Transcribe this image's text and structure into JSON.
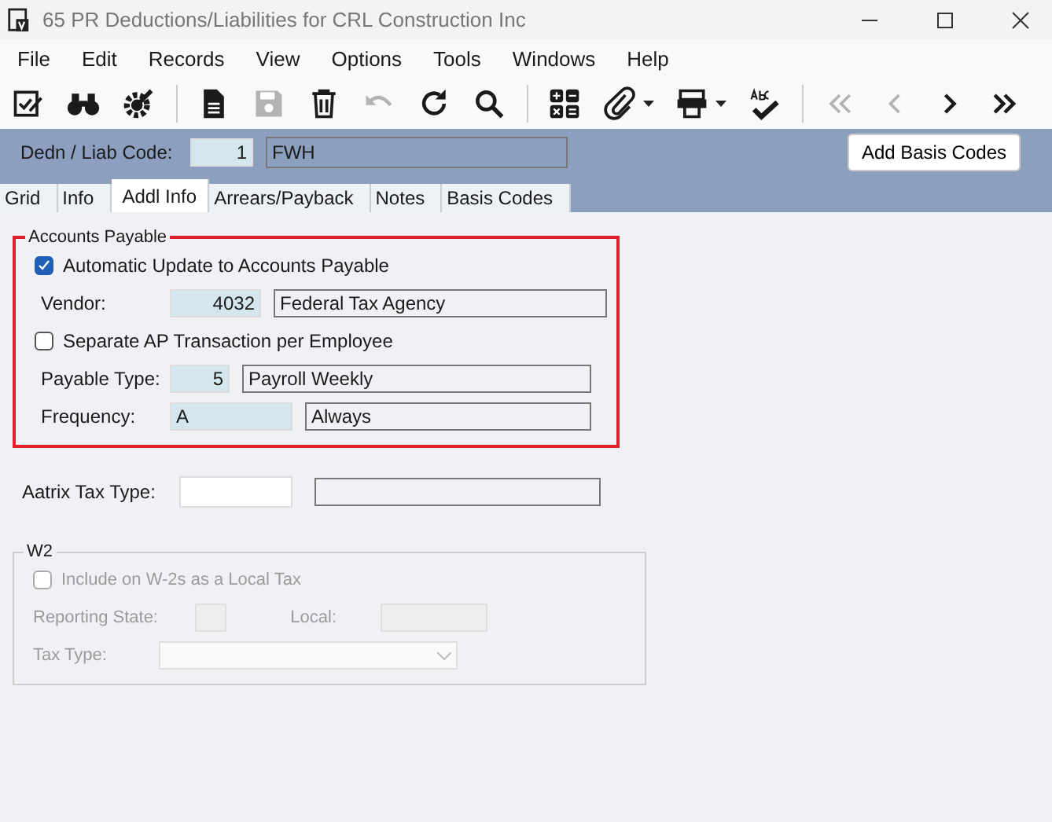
{
  "window": {
    "title": "65 PR Deductions/Liabilities for CRL Construction Inc"
  },
  "menu": [
    "File",
    "Edit",
    "Records",
    "View",
    "Options",
    "Tools",
    "Windows",
    "Help"
  ],
  "toolbar": [
    [
      {
        "kind": "checklist",
        "disabled": false
      },
      {
        "kind": "binoculars",
        "disabled": false
      },
      {
        "kind": "gear",
        "disabled": false
      }
    ],
    [
      {
        "kind": "document",
        "disabled": false
      },
      {
        "kind": "save",
        "disabled": true
      },
      {
        "kind": "trash",
        "disabled": false
      },
      {
        "kind": "undo",
        "disabled": true
      },
      {
        "kind": "refresh",
        "disabled": false
      },
      {
        "kind": "search",
        "disabled": false
      }
    ],
    [
      {
        "kind": "calculator",
        "disabled": false
      },
      {
        "kind": "paperclip",
        "disabled": false,
        "has_menu": true
      },
      {
        "kind": "printer",
        "disabled": false,
        "has_menu": true
      },
      {
        "kind": "spellcheck",
        "disabled": false
      }
    ],
    [
      {
        "kind": "first",
        "disabled": true
      },
      {
        "kind": "prev",
        "disabled": true
      },
      {
        "kind": "next",
        "disabled": false
      },
      {
        "kind": "last",
        "disabled": false
      }
    ]
  ],
  "header": {
    "code_label": "Dedn / Liab Code:",
    "code": "1",
    "description": "FWH",
    "button": "Add Basis Codes"
  },
  "tabs": [
    {
      "label": "Grid",
      "selected": false
    },
    {
      "label": "Info",
      "selected": false
    },
    {
      "label": "Addl Info",
      "selected": true
    },
    {
      "label": "Arrears/Payback",
      "selected": false
    },
    {
      "label": "Notes",
      "selected": false
    },
    {
      "label": "Basis Codes",
      "selected": false
    }
  ],
  "accounts_payable": {
    "title": "Accounts Payable",
    "highlighted": true,
    "auto_update": {
      "label": "Automatic Update to Accounts Payable",
      "checked": true
    },
    "vendor": {
      "label": "Vendor:",
      "code": "4032",
      "name": "Federal Tax Agency"
    },
    "separate": {
      "label": "Separate AP Transaction per Employee",
      "checked": false
    },
    "payable_type": {
      "label": "Payable Type:",
      "code": "5",
      "name": "Payroll Weekly"
    },
    "frequency": {
      "label": "Frequency:",
      "code": "A",
      "name": "Always"
    }
  },
  "aatrix": {
    "label": "Aatrix Tax Type:"
  },
  "w2": {
    "title": "W2",
    "disabled": true,
    "include": {
      "label": "Include on W-2s as a Local Tax",
      "checked": false
    },
    "reporting_state_label": "Reporting State:",
    "local_label": "Local:",
    "tax_type_label": "Tax Type:"
  }
}
